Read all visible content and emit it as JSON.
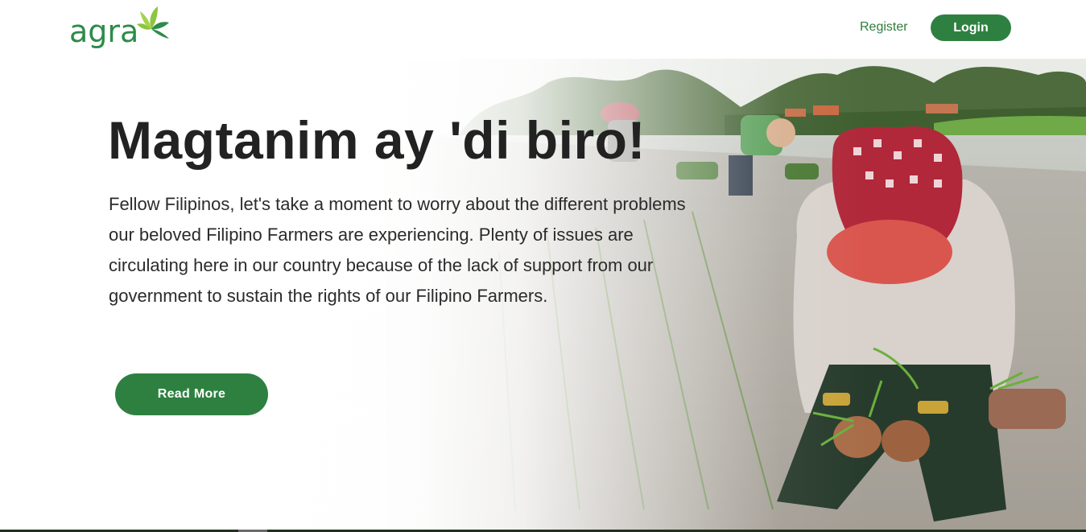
{
  "brand": {
    "name": "agra",
    "color": "#2e8b4a"
  },
  "nav": {
    "register": "Register",
    "login": "Login"
  },
  "hero": {
    "title": "Magtanim ay 'di biro!",
    "text": "Fellow Filipinos, let's take a moment to worry about the different problems our beloved Filipino Farmers are experiencing. Plenty of issues are circulating here in our country because of the lack of support from our government to sustain the rights of our Filipino Farmers.",
    "button": "Read More",
    "accent": "#2e8040"
  }
}
